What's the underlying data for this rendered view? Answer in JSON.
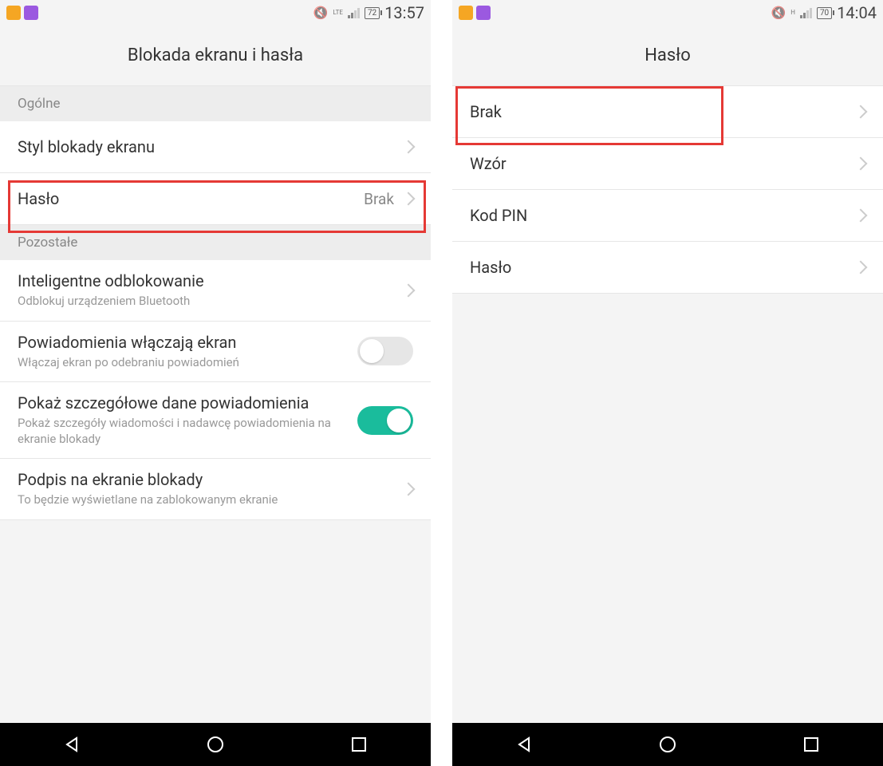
{
  "left": {
    "status": {
      "network": "LTE",
      "battery": "72",
      "time": "13:57"
    },
    "title": "Blokada ekranu i hasła",
    "sections": {
      "general": "Ogólne",
      "other": "Pozostałe"
    },
    "items": {
      "lock_style": "Styl blokady ekranu",
      "password": {
        "label": "Hasło",
        "value": "Brak"
      },
      "smart_unlock": {
        "label": "Inteligentne odblokowanie",
        "sub": "Odblokuj urządzeniem Bluetooth"
      },
      "notif_wake": {
        "label": "Powiadomienia włączają ekran",
        "sub": "Włączaj ekran po odebraniu powiadomień"
      },
      "notif_detail": {
        "label": "Pokaż szczegółowe dane powiadomienia",
        "sub": "Pokaż szczegóły wiadomości i nadawcę powiadomienia na ekranie blokady"
      },
      "lock_signature": {
        "label": "Podpis na ekranie blokady",
        "sub": "To będzie wyświetlane na zablokowanym ekranie"
      }
    }
  },
  "right": {
    "status": {
      "network": "H",
      "battery": "70",
      "time": "14:04"
    },
    "title": "Hasło",
    "options": {
      "none": "Brak",
      "pattern": "Wzór",
      "pin": "Kod PIN",
      "password": "Hasło"
    }
  }
}
